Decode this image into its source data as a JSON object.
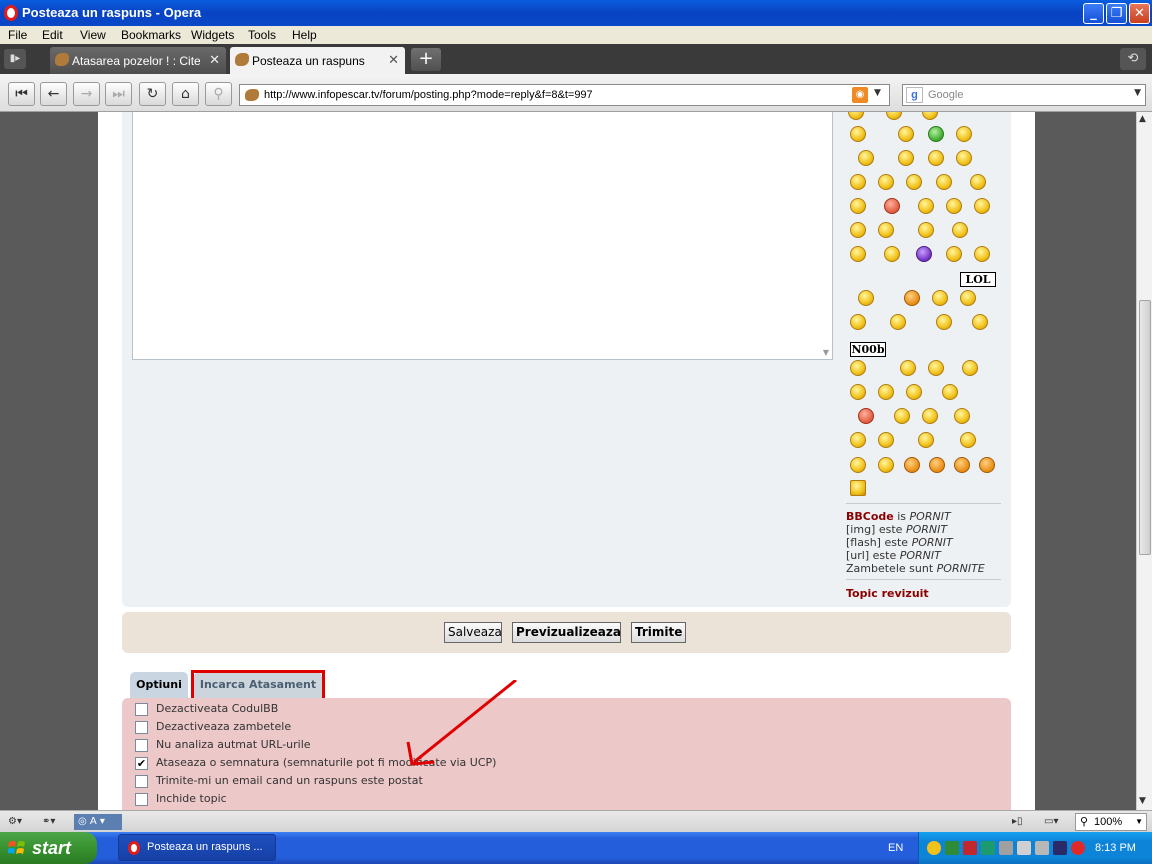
{
  "window": {
    "title": "Posteaza un raspuns - Opera"
  },
  "menu": [
    "File",
    "Edit",
    "View",
    "Bookmarks",
    "Widgets",
    "Tools",
    "Help"
  ],
  "tabs": [
    {
      "label": "Atasarea pozelor ! : Cite...",
      "active": false
    },
    {
      "label": "Posteaza un raspuns",
      "active": true
    }
  ],
  "address": {
    "url": "http://www.infopescar.tv/forum/posting.php?mode=reply&f=8&t=997"
  },
  "search": {
    "placeholder": "Google"
  },
  "smilies": {
    "sign_lol": "LOL",
    "sign_noob": "N00b"
  },
  "bbcode": {
    "bbcode_label": "BBCode",
    "is": "is",
    "pornit": "PORNIT",
    "img_label": "[img]",
    "flash_label": "[flash]",
    "url_label": "[url]",
    "este": "este",
    "smilies_label": "Zambetele",
    "sunt": "sunt",
    "pornite": "PORNITE",
    "topic_review": "Topic revizuit"
  },
  "buttons": {
    "save": "Salveaza",
    "preview": "Previzualizeaza",
    "submit": "Trimite"
  },
  "option_tabs": {
    "options": "Optiuni",
    "upload": "Incarca Atasament"
  },
  "options": [
    {
      "label": "Dezactiveata CodulBB",
      "checked": false
    },
    {
      "label": "Dezactiveaza zambetele",
      "checked": false
    },
    {
      "label": "Nu analiza autmat URL-urile",
      "checked": false
    },
    {
      "label": "Ataseaza o semnatura (semnaturile pot fi modificate via UCP)",
      "checked": true
    },
    {
      "label": "Trimite-mi un email cand un raspuns este postat",
      "checked": false
    },
    {
      "label": "Inchide topic",
      "checked": false
    }
  ],
  "statusbar": {
    "zoom": "100%"
  },
  "taskbar": {
    "start": "start",
    "task": "Posteaza un raspuns ...",
    "lang": "EN",
    "clock": "8:13 PM"
  },
  "colors": {
    "accent_red": "#e00000",
    "titlebar_blue": "#0a48c8",
    "topic_red": "#8b0000"
  }
}
